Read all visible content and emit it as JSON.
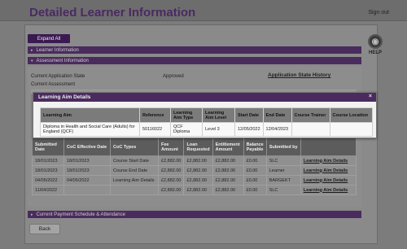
{
  "header": {
    "title": "Detailed Learner Information",
    "sign_out": "Sign out"
  },
  "toolbar": {
    "expand_all": "Expand All",
    "help": "HELP"
  },
  "sections": {
    "learner_information": "Learner Information",
    "assessment_information": "Assessment Information",
    "payment_schedule": "Current Payment Schedule & Attendance"
  },
  "assessment": {
    "current_application_state_label": "Current Application State",
    "current_application_state_value": "Approved",
    "application_state_history": "Application State History",
    "current_assessment_label": "Current Assessment"
  },
  "modal": {
    "title": "Learning Aim Details",
    "close": "×",
    "columns": [
      "Learning Aim",
      "Reference",
      "Learning Aim Type",
      "Learning Aim Level",
      "Start Date",
      "End Date",
      "Course Trainer",
      "Course Location"
    ],
    "row": [
      "Diploma in Health and Social Care (Adults) for England (QCF)",
      "50116022",
      "QCF Diploma",
      "Level 3",
      "12/05/2022",
      "12/04/2023",
      "",
      ""
    ]
  },
  "coc": {
    "columns": [
      "Submitted Date",
      "CoC Effective Date",
      "CoC Types",
      "Fee Amount",
      "Loan Requested",
      "Entitlement Amount",
      "Balance Payable",
      "Submitted by",
      ""
    ],
    "rows": [
      [
        "18/01/2023",
        "18/01/2023",
        "Course Start Date",
        "£2,882.00",
        "£2,882.00",
        "£2,882.00",
        "£0.00",
        "SLC",
        "Learning Aim Details"
      ],
      [
        "18/01/2023",
        "18/01/2023",
        "Course End Date",
        "£2,882.00",
        "£2,882.00",
        "£2,882.00",
        "£0.00",
        "Learner",
        "Learning Aim Details"
      ],
      [
        "04/05/2022",
        "04/05/2022",
        "Learning Aim Details",
        "£2,882.00",
        "£2,882.00",
        "£2,882.00",
        "£0.00",
        "BARGEKT",
        "Learning Aim Details"
      ],
      [
        "11/04/2022",
        "",
        "",
        "£2,882.00",
        "£2,882.00",
        "£2,882.00",
        "£0.00",
        "SLC",
        "Learning Aim Details"
      ]
    ]
  },
  "footer": {
    "back": "Back"
  }
}
